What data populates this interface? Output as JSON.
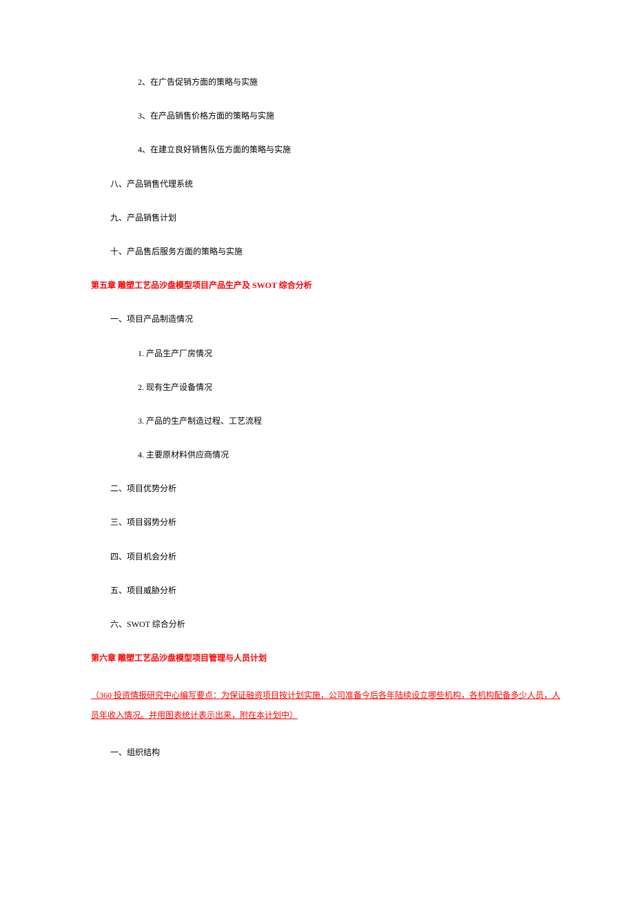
{
  "section_a": {
    "items_l3": [
      "2、在广告促销方面的策略与实施",
      "3、在产品销售价格方面的策略与实施",
      "4、在建立良好销售队伍方面的策略与实施"
    ],
    "items_l2": [
      "八、产品销售代理系统",
      "九、产品销售计划",
      "十、产品售后服务方面的策略与实施"
    ]
  },
  "chapter5": {
    "title": "第五章 雕塑工艺品沙盘模型项目产品生产及 SWOT 综合分析",
    "sec1": {
      "heading": "一、项目产品制造情况",
      "items": [
        "1. 产品生产厂房情况",
        "2. 现有生产设备情况",
        "3. 产品的生产制造过程、工艺流程",
        "4. 主要原材料供应商情况"
      ]
    },
    "items_l2": [
      "二、项目优势分析",
      "三、项目弱势分析",
      "四、项目机会分析",
      "五、项目威胁分析",
      "六、SWOT 综合分析"
    ]
  },
  "chapter6": {
    "title": "第六章 雕塑工艺品沙盘模型项目管理与人员计划",
    "note": "（360 投资情报研究中心编写要点：为保证融资项目按计划实施，公司准备今后各年陆续设立哪些机构，各机构配备多少人员，人员年收入情况。并用图表统计表示出来，附在本计划中）",
    "items_l2": [
      "一、组织结构"
    ]
  }
}
